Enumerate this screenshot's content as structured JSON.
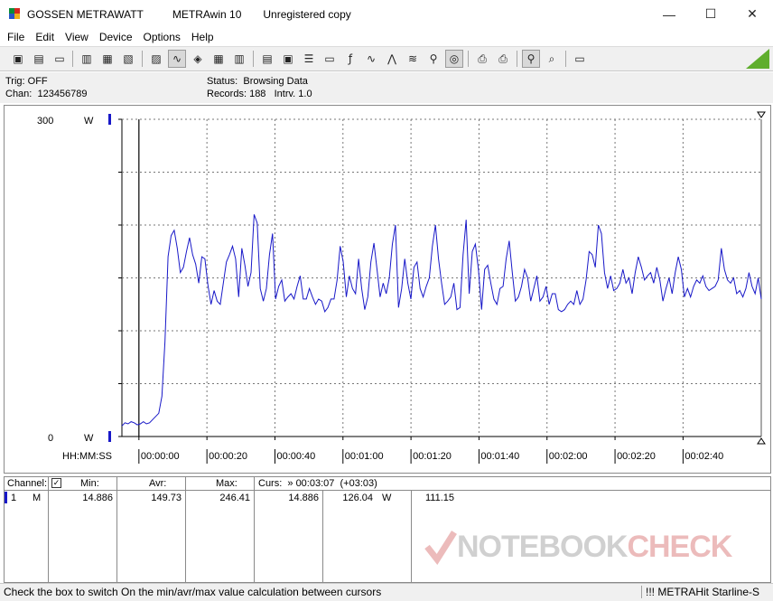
{
  "window": {
    "title_parts": [
      "GOSSEN METRAWATT",
      "METRAwin 10",
      "Unregistered copy"
    ],
    "minimize": "—",
    "maximize": "☐",
    "close": "✕"
  },
  "menu": [
    "File",
    "Edit",
    "View",
    "Device",
    "Options",
    "Help"
  ],
  "toolbar": {
    "icons": [
      "open-file-icon",
      "save-icon",
      "folder-icon",
      "device-connect-icon",
      "device-icon",
      "device-send-icon",
      "scope-view-icon",
      "trend-view-icon",
      "table-view-icon",
      "bar-view-icon",
      "print-setup-icon",
      "print-list-icon",
      "list-icon",
      "computer-icon",
      "function-icon",
      "wave-icon",
      "wave-alt-icon",
      "wave-dense-icon",
      "search-icon",
      "target-icon",
      "printer-icon",
      "printer-alt-icon",
      "zoom-icon",
      "cursor-icon",
      "comment-icon"
    ],
    "accent": "#5fae2d"
  },
  "info": {
    "trig": "Trig: OFF",
    "chan": "Chan:  123456789",
    "status": "Status:  Browsing Data",
    "records": "Records: 188   Intrv. 1.0"
  },
  "chart_data": {
    "type": "line",
    "y_top_label": "300",
    "y_bottom_label": "0",
    "y_unit": "W",
    "ylim": [
      0,
      300
    ],
    "x_axis_label": "HH:MM:SS",
    "x_ticks": [
      "00:00:00",
      "00:00:20",
      "00:00:40",
      "00:01:00",
      "00:01:20",
      "00:01:40",
      "00:02:00",
      "00:02:20",
      "00:02:40"
    ],
    "xlim": [
      -5,
      183
    ],
    "grid": true,
    "line_color": "#1818c8",
    "series": [
      {
        "values": [
          10,
          13,
          12,
          14,
          13,
          11,
          12,
          14,
          12,
          13,
          16,
          19,
          22,
          38,
          90,
          170,
          190,
          195,
          178,
          155,
          160,
          175,
          188,
          172,
          163,
          145,
          170,
          168,
          143,
          125,
          138,
          128,
          125,
          145,
          165,
          172,
          180,
          168,
          132,
          178,
          162,
          142,
          155,
          210,
          202,
          140,
          128,
          140,
          172,
          192,
          130,
          142,
          148,
          128,
          132,
          135,
          130,
          142,
          152,
          130,
          130,
          140,
          132,
          125,
          130,
          128,
          118,
          122,
          130,
          130,
          148,
          180,
          165,
          132,
          152,
          140,
          135,
          168,
          140,
          120,
          132,
          165,
          183,
          158,
          132,
          145,
          135,
          150,
          182,
          200,
          122,
          140,
          168,
          145,
          130,
          160,
          165,
          140,
          132,
          142,
          150,
          180,
          200,
          168,
          145,
          125,
          128,
          132,
          145,
          120,
          122,
          172,
          205,
          135,
          175,
          182,
          158,
          120,
          158,
          162,
          145,
          130,
          125,
          140,
          142,
          168,
          185,
          155,
          128,
          132,
          142,
          158,
          150,
          128,
          140,
          152,
          128,
          132,
          142,
          125,
          135,
          135,
          120,
          118,
          120,
          125,
          128,
          125,
          138,
          125,
          130,
          148,
          175,
          172,
          160,
          200,
          192,
          155,
          140,
          152,
          138,
          140,
          145,
          158,
          145,
          150,
          135,
          155,
          170,
          160,
          148,
          152,
          155,
          145,
          160,
          148,
          128,
          140,
          150,
          135,
          155,
          170,
          158,
          132,
          140,
          132,
          142,
          148,
          145,
          152,
          142,
          138,
          140,
          142,
          148,
          178,
          158,
          148,
          145,
          150,
          135,
          138,
          132,
          140,
          155,
          142,
          135,
          150,
          130
        ],
        "values_note_free": true
      }
    ]
  },
  "table": {
    "headers": {
      "channel": "Channel:",
      "min": "Min:",
      "avr": "Avr:",
      "max": "Max:",
      "curs": "Curs:  » 00:03:07  (+03:03)"
    },
    "checkbox": "✓",
    "row": {
      "chan": "1",
      "mode": "M",
      "min": "14.886",
      "avr": "149.73",
      "max": "246.41",
      "curs1": "14.886",
      "curs2": "126.04",
      "unit": "W",
      "diff": "111.15"
    }
  },
  "watermark": {
    "left": "NOTEBOOK",
    "right": "CHECK"
  },
  "status": {
    "hint": "Check the box to switch On the min/avr/max value calculation between cursors",
    "device": "!!! METRAHit Starline-S"
  }
}
